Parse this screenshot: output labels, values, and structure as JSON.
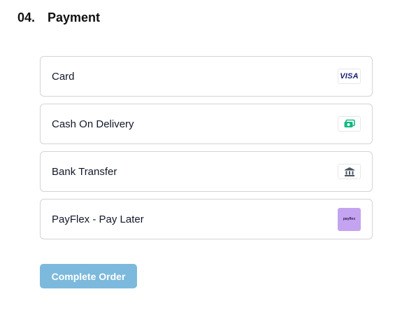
{
  "section": {
    "number": "04.",
    "title": "Payment"
  },
  "payment_options": [
    {
      "label": "Card",
      "icon": "visa-logo-icon",
      "icon_text": "VISA"
    },
    {
      "label": "Cash On Delivery",
      "icon": "cash-icon"
    },
    {
      "label": "Bank Transfer",
      "icon": "bank-icon"
    },
    {
      "label": "PayFlex - Pay Later",
      "icon": "payflex-logo-icon",
      "icon_text": "payflex"
    }
  ],
  "complete_button": {
    "label": "Complete Order"
  },
  "colors": {
    "button_bg": "#7cb9dc",
    "cash_icon": "#10b981",
    "bank_icon": "#4b5563",
    "payflex_bg": "#c4a3f0",
    "visa": "#1a1f71"
  }
}
